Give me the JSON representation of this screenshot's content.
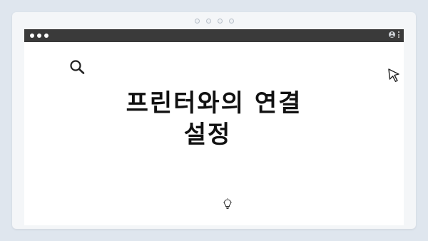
{
  "window": {
    "controls": [
      "close",
      "minimize",
      "maximize"
    ],
    "toolbar_icons": [
      "account-icon",
      "more-vert-icon"
    ]
  },
  "slide": {
    "title_line1": "프린터와의 연결",
    "title_line2": "설정"
  },
  "icons": {
    "decor_left": "search-icon",
    "decor_right": "cursor-arrow-icon",
    "decor_bottom": "lightbulb-icon"
  },
  "colors": {
    "page_background": "#dfe6ee",
    "frame_background": "#f4f6f8",
    "titlebar": "#3a3a3a",
    "canvas": "#ffffff",
    "title_text": "#111111"
  }
}
